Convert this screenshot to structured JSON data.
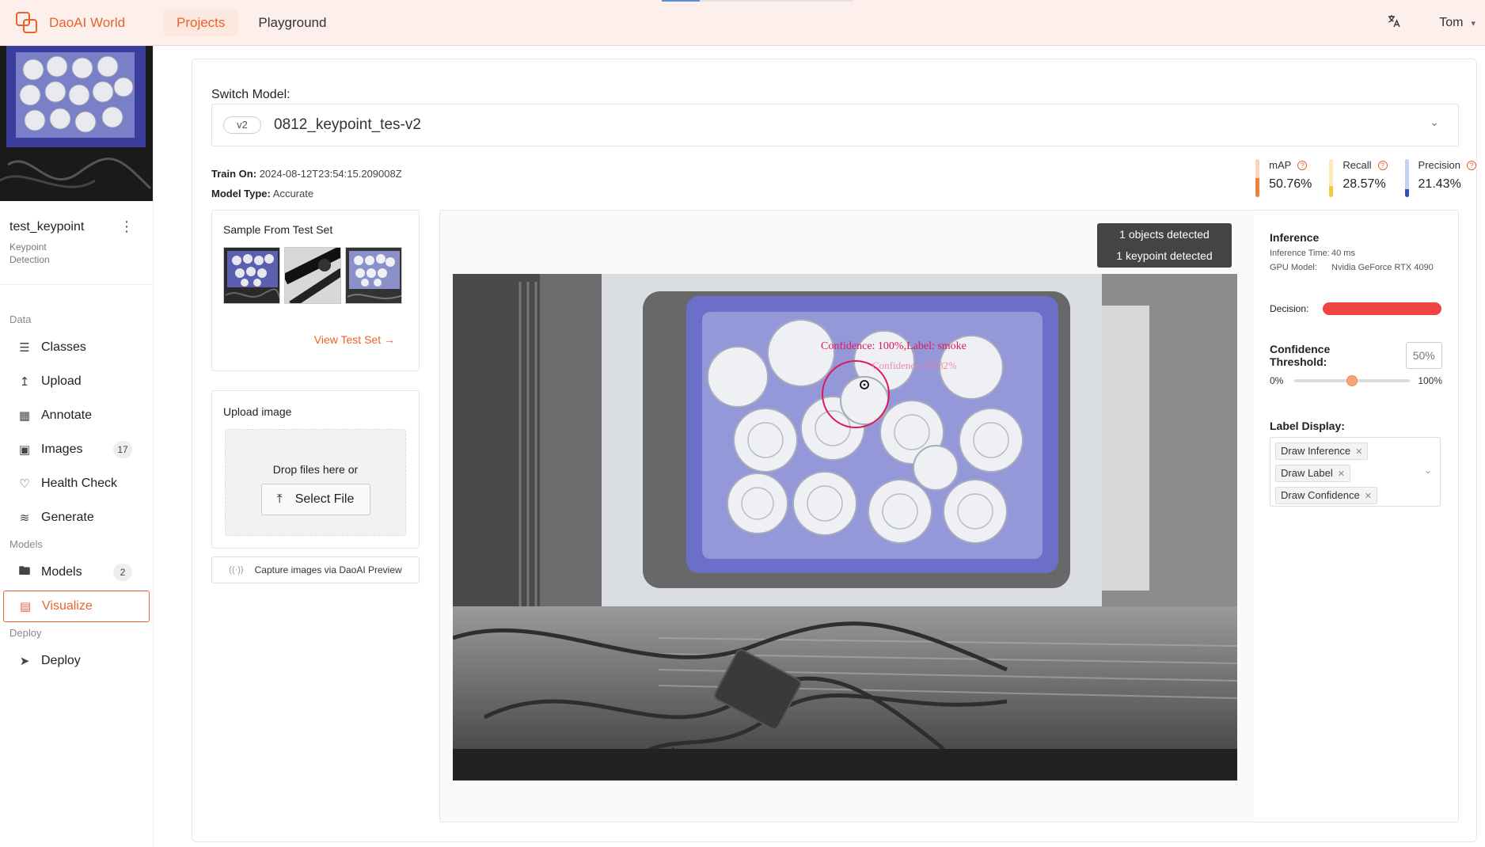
{
  "app": {
    "brand": "DaoAI World",
    "nav": [
      {
        "label": "Projects",
        "active": true
      },
      {
        "label": "Playground",
        "active": false
      }
    ],
    "user": "Tom",
    "accent_color": "#e8632b"
  },
  "sidebar": {
    "project_name": "test_keypoint",
    "project_type": "Keypoint Detection",
    "sections": {
      "data": "Data",
      "models": "Models",
      "deploy": "Deploy"
    },
    "items": {
      "classes": "Classes",
      "upload": "Upload",
      "annotate": "Annotate",
      "images": "Images",
      "images_count": "17",
      "health_check": "Health Check",
      "generate": "Generate",
      "models": "Models",
      "models_count": "2",
      "visualize": "Visualize",
      "deploy": "Deploy"
    }
  },
  "main": {
    "switch_model_label": "Switch Model:",
    "model_version": "v2",
    "model_name": "0812_keypoint_tes-v2",
    "train_on_label": "Train On:",
    "train_on_value": "2024-08-12T23:54:15.209008Z",
    "model_type_label": "Model Type:",
    "model_type_value": "Accurate",
    "metrics": [
      {
        "name": "mAP",
        "value": "50.76%",
        "fraction": 0.5076,
        "color": "#f0803c",
        "track": "#fbd3c0"
      },
      {
        "name": "Recall",
        "value": "28.57%",
        "fraction": 0.2857,
        "color": "#f5c842",
        "track": "#fbeab6"
      },
      {
        "name": "Precision",
        "value": "21.43%",
        "fraction": 0.2143,
        "color": "#2f4fb5",
        "track": "#c3d3f2"
      }
    ],
    "sample_title": "Sample From Test Set",
    "view_test_set": "View Test Set",
    "upload_title": "Upload image",
    "drop_text": "Drop files here or",
    "select_file": "Select File",
    "capture": "Capture images via DaoAI Preview"
  },
  "viewer": {
    "objects_detected": "1 objects detected",
    "keypoint_detected": "1 keypoint detected",
    "overlay_label_1": "Confidence: 100%,Label: smoke",
    "overlay_label_2": "Confidence: 99.82%"
  },
  "inference": {
    "title": "Inference",
    "time_label": "Inference Time:",
    "time_value": "40 ms",
    "gpu_label": "GPU Model:",
    "gpu_value": "Nvidia GeForce RTX 4090",
    "decision_label": "Decision:",
    "decision_color": "#ef4444",
    "threshold_label": "Confidence Threshold:",
    "threshold_value": "50%",
    "threshold_fraction": 0.5,
    "slider_min": "0%",
    "slider_max": "100%",
    "label_display_title": "Label Display:",
    "tags": [
      "Draw Inference",
      "Draw Label",
      "Draw Confidence"
    ]
  }
}
